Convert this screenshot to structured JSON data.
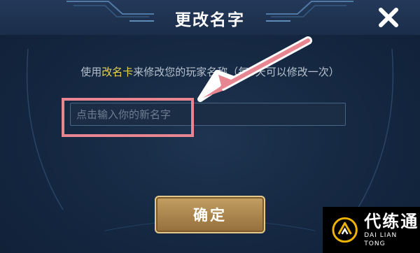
{
  "dialog": {
    "title": "更改名字",
    "description": {
      "prefix": "使用",
      "highlight_card": "改名卡",
      "middle": "来修改您的玩家名称（每",
      "highlight_days": "3",
      "suffix": "天可以修改一次）"
    },
    "name_input": {
      "value": "",
      "placeholder": "点击输入你的新名字"
    },
    "confirm_label": "确定",
    "close_icon": "close-icon"
  },
  "annotation": {
    "arrow_color": "#e78591",
    "box_color": "#e78591"
  },
  "watermark": {
    "name_cn": "代练通",
    "name_en": "DAI LIAN TONG"
  },
  "colors": {
    "highlight_text": "#e6d44a",
    "button_gold": "#a9844c",
    "panel_bg": "#162943"
  }
}
